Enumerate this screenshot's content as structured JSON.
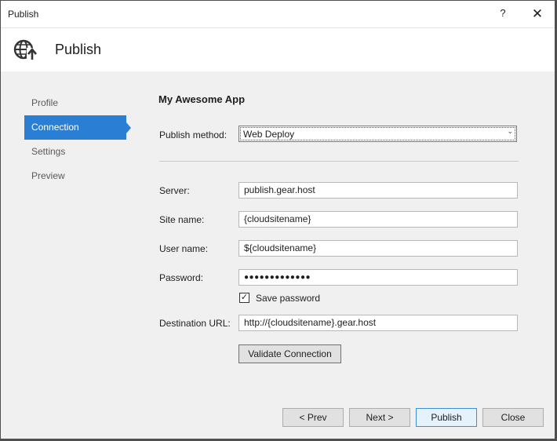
{
  "window": {
    "title": "Publish",
    "help_glyph": "?",
    "close_glyph": "✕"
  },
  "header": {
    "title": "Publish",
    "icon": "publish-globe-icon"
  },
  "nav": {
    "items": [
      {
        "label": "Profile"
      },
      {
        "label": "Connection",
        "active": true
      },
      {
        "label": "Settings"
      },
      {
        "label": "Preview"
      }
    ]
  },
  "form": {
    "app_title": "My Awesome App",
    "publish_method": {
      "label": "Publish method:",
      "value": "Web Deploy"
    },
    "server": {
      "label": "Server:",
      "value": "publish.gear.host"
    },
    "site_name": {
      "label": "Site name:",
      "value": "{cloudsitename}"
    },
    "user_name": {
      "label": "User name:",
      "value": "${cloudsitename}"
    },
    "password": {
      "label": "Password:",
      "value": "●●●●●●●●●●●●●"
    },
    "save_password": {
      "label": "Save password",
      "checked": true,
      "check_glyph": "✓"
    },
    "destination_url": {
      "label": "Destination URL:",
      "value": "http://{cloudsitename}.gear.host"
    },
    "validate_label": "Validate Connection"
  },
  "footer": {
    "prev_label": "< Prev",
    "next_label": "Next >",
    "publish_label": "Publish",
    "close_label": "Close"
  },
  "colors": {
    "accent": "#2a7fd4",
    "background": "#f0f0f0"
  }
}
